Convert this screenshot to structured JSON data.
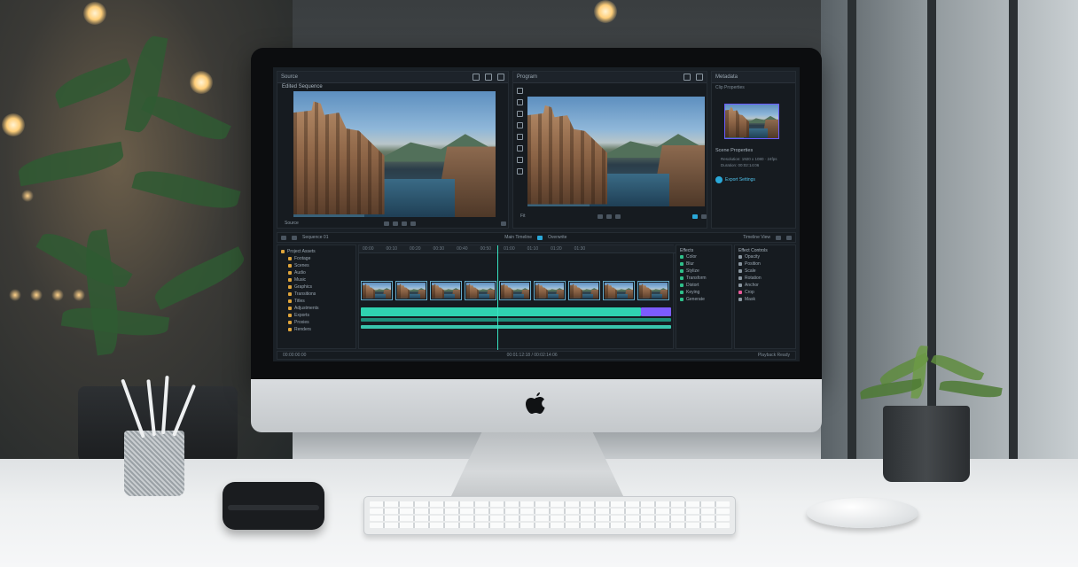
{
  "scene": {
    "description_colors": {
      "accent": "#2aa8d8",
      "track_green": "#2fd3b0",
      "track_purple": "#7c5cff",
      "bg_ui": "#161b20"
    }
  },
  "editor": {
    "source_panel": {
      "title": "Source",
      "clip_label": "Edited Sequence",
      "timecode_left": "Source",
      "icons": [
        "plus-icon",
        "settings-icon",
        "menu-icon"
      ]
    },
    "program_panel": {
      "title": "Program",
      "timecode_left": "Fit"
    },
    "inspector": {
      "title": "Metadata",
      "subtitle": "Clip Properties",
      "section_title": "Scene Properties",
      "line1": "Resolution: 1920 x 1080 · 24fps",
      "line2": "Duration: 00:02:14:06",
      "link_label": "Export Settings"
    },
    "timeline_toolbar": {
      "label_left": "Sequence 01",
      "label_mid": "Main Timeline",
      "label_mode": "Overwrite",
      "label_right": "Timeline View"
    },
    "project_tree": {
      "root": "Project Assets",
      "items": [
        "Footage",
        "Scenes",
        "Audio",
        "Music",
        "Graphics",
        "Transitions",
        "Titles",
        "Adjustments",
        "Exports",
        "Proxies",
        "Renders"
      ]
    },
    "effects_list": {
      "title": "Effects",
      "items": [
        "Color",
        "Blur",
        "Stylize",
        "Transform",
        "Distort",
        "Keying",
        "Generate"
      ]
    },
    "properties_panel": {
      "title": "Effect Controls",
      "items": [
        "Opacity",
        "Position",
        "Scale",
        "Rotation",
        "Anchor",
        "Crop",
        "Mask"
      ]
    },
    "status_bar": {
      "left": "00:00:00:00",
      "center": "00:01:12:18 / 00:02:14:06",
      "right": "Playback Ready"
    }
  }
}
